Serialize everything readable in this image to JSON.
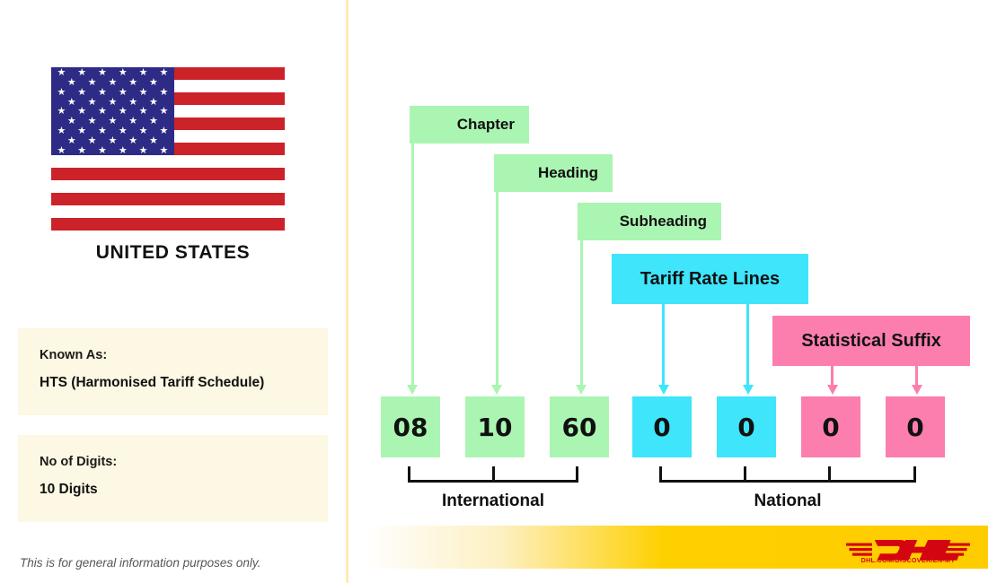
{
  "country": {
    "name": "UNITED STATES",
    "flag_icon": "us-flag-icon",
    "flag_colors": {
      "red": "#cc2229",
      "blue": "#2e2b86",
      "white": "#ffffff"
    },
    "star_count": 50,
    "stripe_count": 13
  },
  "info_cards": [
    {
      "label": "Known As:",
      "value": "HTS (Harmonised Tariff Schedule)"
    },
    {
      "label": "No of Digits:",
      "value": "10 Digits"
    }
  ],
  "disclaimer": "This is for general information purposes only.",
  "diagram": {
    "labels": [
      {
        "text": "Chapter",
        "color": "#abf5b2",
        "group": "international"
      },
      {
        "text": "Heading",
        "color": "#abf5b2",
        "group": "international"
      },
      {
        "text": "Subheading",
        "color": "#abf5b2",
        "group": "international"
      },
      {
        "text": "Tariff Rate Lines",
        "color": "#3ee5fb",
        "group": "national"
      },
      {
        "text": "Statistical Suffix",
        "color": "#fc7eae",
        "group": "national"
      }
    ],
    "digits": [
      {
        "value": "08",
        "color": "#abf5b2",
        "group": "international"
      },
      {
        "value": "10",
        "color": "#abf5b2",
        "group": "international"
      },
      {
        "value": "60",
        "color": "#abf5b2",
        "group": "international"
      },
      {
        "value": "0",
        "color": "#3ee5fb",
        "group": "national"
      },
      {
        "value": "0",
        "color": "#3ee5fb",
        "group": "national"
      },
      {
        "value": "0",
        "color": "#fc7eae",
        "group": "national"
      },
      {
        "value": "0",
        "color": "#fc7eae",
        "group": "national"
      }
    ],
    "groups": [
      {
        "label": "International",
        "span_digits": 3
      },
      {
        "label": "National",
        "span_digits": 4
      }
    ]
  },
  "footer": {
    "brand": "DHL",
    "brand_color": "#d40511",
    "strip_color": "#ffcc00",
    "url": "DHL.COM/DISCOVER/EN-MY"
  }
}
